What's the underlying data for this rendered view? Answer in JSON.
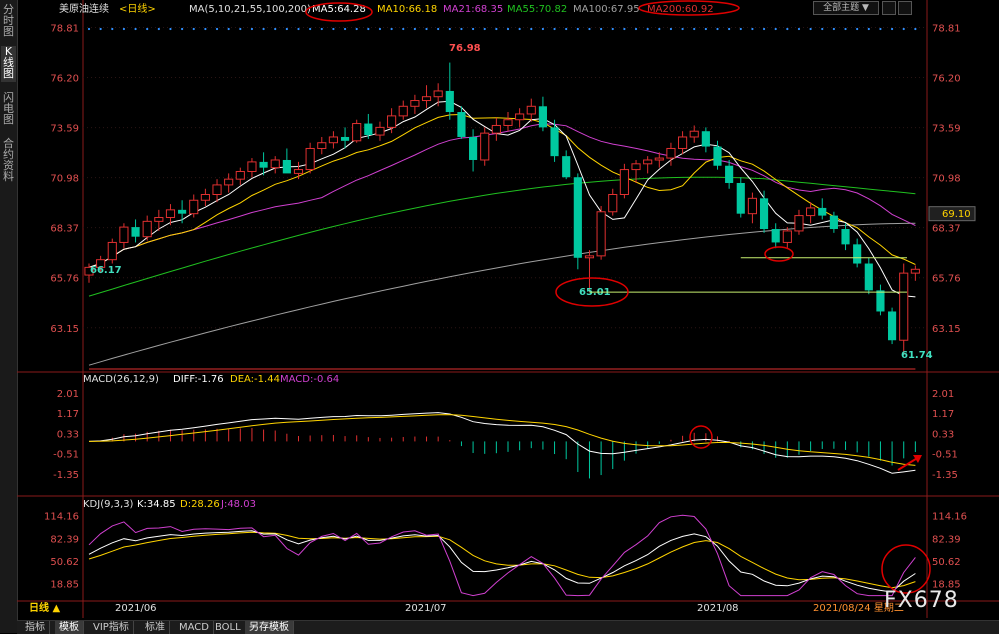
{
  "left_tabs": [
    "分时图",
    "K线图",
    "闪电图",
    "合约资料"
  ],
  "header": {
    "symbol": "美原油连续",
    "period": "<日线>",
    "ma_params": "MA(5,10,21,55,100,200)",
    "ma": [
      {
        "label": "MA5:64.28",
        "color": "#ffffff"
      },
      {
        "label": "MA10:66.18",
        "color": "#ffd400"
      },
      {
        "label": "MA21:68.35",
        "color": "#d040d0"
      },
      {
        "label": "MA55:70.82",
        "color": "#20c020"
      },
      {
        "label": "MA100:67.95",
        "color": "#a0a0a0"
      },
      {
        "label": "MA200:60.92",
        "color": "#e03030"
      }
    ],
    "theme_button": "全部主题",
    "theme_arrow": "▼"
  },
  "colors": {
    "up": "#e03030",
    "down": "#00c8a0",
    "grid": "#2a1414",
    "axis": "#8a1a1a"
  },
  "price_axis": {
    "min": 61.0,
    "max": 79.2,
    "ticks": [
      "78.81",
      "76.20",
      "73.59",
      "70.98",
      "68.37",
      "65.76",
      "63.15"
    ],
    "current": "69.10"
  },
  "price_annotations": {
    "high": "76.98",
    "low": "61.74",
    "left_low": "66.17",
    "circled_low": "65.01"
  },
  "macd": {
    "header": "MACD(26,12,9)",
    "diff": "DIFF:-1.76",
    "dea": "DEA:-1.44",
    "macd": "MACD:-0.64",
    "ticks": [
      "2.01",
      "1.17",
      "0.33",
      "-0.51",
      "-1.35"
    ],
    "min": -2.1,
    "max": 2.3
  },
  "kdj": {
    "header": "KDJ(9,3,3)",
    "k": "K:34.85",
    "d": "D:28.26",
    "j": "J:48.03",
    "ticks": [
      "114.16",
      "82.39",
      "50.62",
      "18.85"
    ],
    "min": 0,
    "max": 125
  },
  "x_labels": [
    "2021/06",
    "2021/07",
    "2021/08"
  ],
  "date_label": "2021/08/24 星期二",
  "period_button": "日线 ▲",
  "bottom_tabs": [
    "指标",
    "模板",
    "VIP指标",
    "标准",
    "MACD",
    "BOLL",
    "另存模板"
  ],
  "watermark": "FX678",
  "chart_data": {
    "type": "candlestick",
    "candles": [
      [
        65.9,
        66.5,
        65.5,
        66.3
      ],
      [
        66.3,
        66.9,
        66.0,
        66.7
      ],
      [
        66.7,
        67.8,
        66.5,
        67.6
      ],
      [
        67.6,
        68.6,
        67.3,
        68.4
      ],
      [
        68.4,
        68.8,
        67.6,
        67.9
      ],
      [
        67.9,
        69.0,
        67.7,
        68.7
      ],
      [
        68.7,
        69.3,
        68.2,
        68.9
      ],
      [
        68.9,
        69.6,
        68.5,
        69.3
      ],
      [
        69.3,
        69.8,
        68.6,
        69.1
      ],
      [
        69.1,
        70.1,
        68.9,
        69.8
      ],
      [
        69.8,
        70.4,
        69.5,
        70.1
      ],
      [
        70.1,
        70.9,
        69.7,
        70.6
      ],
      [
        70.6,
        71.2,
        70.2,
        70.9
      ],
      [
        70.9,
        71.5,
        70.6,
        71.3
      ],
      [
        71.3,
        72.0,
        71.0,
        71.8
      ],
      [
        71.8,
        72.3,
        71.1,
        71.5
      ],
      [
        71.5,
        72.1,
        71.2,
        71.9
      ],
      [
        71.9,
        72.5,
        71.4,
        71.2
      ],
      [
        71.2,
        71.8,
        70.9,
        71.4
      ],
      [
        71.4,
        72.8,
        71.2,
        72.5
      ],
      [
        72.5,
        73.1,
        72.2,
        72.8
      ],
      [
        72.8,
        73.4,
        72.5,
        73.1
      ],
      [
        73.1,
        73.6,
        72.5,
        72.9
      ],
      [
        72.9,
        74.0,
        72.8,
        73.8
      ],
      [
        73.8,
        74.3,
        73.0,
        73.2
      ],
      [
        73.2,
        73.9,
        72.9,
        73.6
      ],
      [
        73.6,
        74.6,
        73.3,
        74.2
      ],
      [
        74.2,
        75.0,
        74.0,
        74.7
      ],
      [
        74.7,
        75.3,
        74.3,
        75.0
      ],
      [
        75.0,
        75.8,
        74.6,
        75.2
      ],
      [
        75.2,
        75.9,
        74.7,
        75.5
      ],
      [
        75.5,
        76.98,
        74.0,
        74.4
      ],
      [
        74.4,
        74.7,
        73.0,
        73.1
      ],
      [
        73.1,
        73.5,
        71.3,
        71.9
      ],
      [
        71.9,
        73.6,
        71.6,
        73.3
      ],
      [
        73.3,
        74.1,
        72.9,
        73.7
      ],
      [
        73.7,
        74.4,
        73.4,
        74.0
      ],
      [
        74.0,
        74.6,
        73.6,
        74.3
      ],
      [
        74.3,
        75.1,
        73.9,
        74.7
      ],
      [
        74.7,
        75.2,
        73.4,
        73.6
      ],
      [
        73.6,
        74.0,
        71.8,
        72.1
      ],
      [
        72.1,
        72.4,
        70.9,
        71.0
      ],
      [
        71.0,
        71.2,
        66.2,
        66.8
      ],
      [
        66.8,
        67.2,
        65.01,
        66.9
      ],
      [
        66.9,
        69.5,
        66.7,
        69.2
      ],
      [
        69.2,
        70.4,
        69.0,
        70.1
      ],
      [
        70.1,
        71.7,
        69.9,
        71.4
      ],
      [
        71.4,
        71.9,
        70.7,
        71.7
      ],
      [
        71.7,
        72.1,
        71.2,
        71.9
      ],
      [
        71.9,
        72.3,
        71.5,
        72.0
      ],
      [
        72.0,
        72.8,
        71.6,
        72.5
      ],
      [
        72.5,
        73.4,
        72.2,
        73.1
      ],
      [
        73.1,
        73.7,
        72.8,
        73.4
      ],
      [
        73.4,
        73.6,
        72.3,
        72.6
      ],
      [
        72.6,
        72.9,
        71.4,
        71.6
      ],
      [
        71.6,
        71.9,
        70.4,
        70.7
      ],
      [
        70.7,
        71.0,
        68.9,
        69.1
      ],
      [
        69.1,
        70.2,
        68.6,
        69.9
      ],
      [
        69.9,
        70.3,
        68.1,
        68.3
      ],
      [
        68.3,
        68.6,
        67.3,
        67.6
      ],
      [
        67.6,
        68.4,
        67.3,
        68.2
      ],
      [
        68.2,
        69.3,
        68.0,
        69.0
      ],
      [
        69.0,
        69.7,
        68.6,
        69.4
      ],
      [
        69.4,
        69.9,
        68.8,
        69.0
      ],
      [
        69.0,
        69.2,
        68.1,
        68.3
      ],
      [
        68.3,
        68.6,
        67.2,
        67.5
      ],
      [
        67.5,
        67.8,
        66.3,
        66.5
      ],
      [
        66.5,
        66.8,
        64.9,
        65.1
      ],
      [
        65.1,
        65.4,
        63.8,
        64.0
      ],
      [
        64.0,
        64.2,
        62.3,
        62.5
      ],
      [
        62.5,
        66.5,
        61.74,
        66.0
      ],
      [
        66.0,
        66.4,
        65.6,
        66.2
      ]
    ],
    "x_labels": [
      "2021/06",
      "2021/07",
      "2021/08"
    ]
  }
}
